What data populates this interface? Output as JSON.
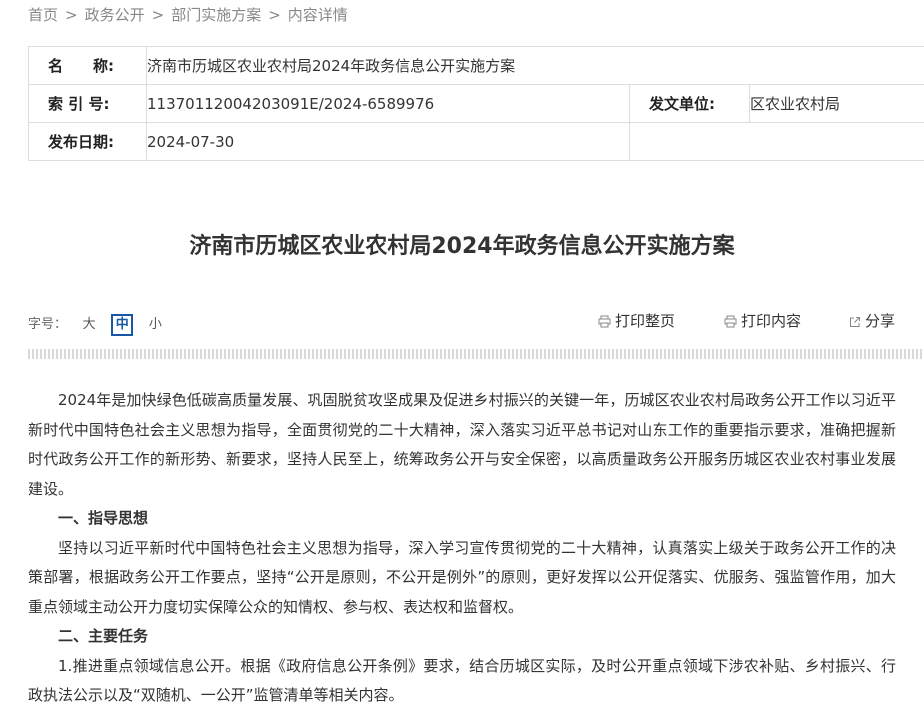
{
  "breadcrumb": {
    "items": [
      "首页",
      "政务公开",
      "部门实施方案",
      "内容详情"
    ],
    "separator": ">"
  },
  "meta": {
    "name_label": "名　　称:",
    "name_value": "济南市历城区农业农村局2024年政务信息公开实施方案",
    "index_label": "索 引 号:",
    "index_value": "11370112004203091E/2024-6589976",
    "issuer_label": "发文单位:",
    "issuer_value": "区农业农村局",
    "date_label": "发布日期:",
    "date_value": "2024-07-30"
  },
  "article": {
    "title": "济南市历城区农业农村局2024年政务信息公开实施方案",
    "paragraphs": [
      "2024年是加快绿色低碳高质量发展、巩固脱贫攻坚成果及促进乡村振兴的关键一年，历城区农业农村局政务公开工作以习近平新时代中国特色社会主义思想为指导，全面贯彻党的二十大精神，深入落实习近平总书记对山东工作的重要指示要求，准确把握新时代政务公开工作的新形势、新要求，坚持人民至上，统筹政务公开与安全保密，以高质量政务公开服务历城区农业农村事业发展建设。",
      "一、指导思想",
      "坚持以习近平新时代中国特色社会主义思想为指导，深入学习宣传贯彻党的二十大精神，认真落实上级关于政务公开工作的决策部署，根据政务公开工作要点，坚持“公开是原则，不公开是例外”的原则，更好发挥以公开促落实、优服务、强监管作用，加大重点领域主动公开力度切实保障公众的知情权、参与权、表达权和监督权。",
      "二、主要任务",
      "1.推进重点领域信息公开。根据《政府信息公开条例》要求，结合历城区实际，及时公开重点领域下涉农补贴、乡村振兴、行政执法公示以及“双随机、一公开”监管清单等相关内容。"
    ]
  },
  "toolbar": {
    "font_size_label": "字号：",
    "font_large": "大",
    "font_medium": "中",
    "font_small": "小",
    "print_page": "打印整页",
    "print_content": "打印内容",
    "share": "分享"
  },
  "colors": {
    "accent": "#1a56a8",
    "text": "#333333",
    "muted": "#888888",
    "border": "#dddddd"
  }
}
